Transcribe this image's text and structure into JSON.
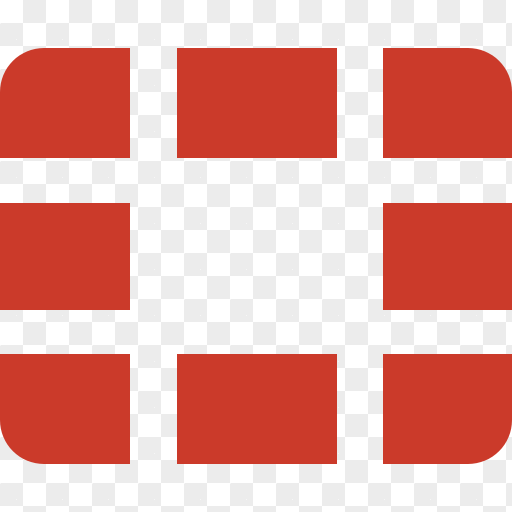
{
  "logo": {
    "name": "grid-logo",
    "color": "#cb3a2a",
    "rows": [
      [
        "tile",
        "tile",
        "tile"
      ],
      [
        "tile",
        "empty",
        "tile"
      ],
      [
        "tile",
        "tile",
        "tile"
      ]
    ]
  },
  "canvas": {
    "checker_light": "#ffffff",
    "checker_dark": "#ececec"
  }
}
